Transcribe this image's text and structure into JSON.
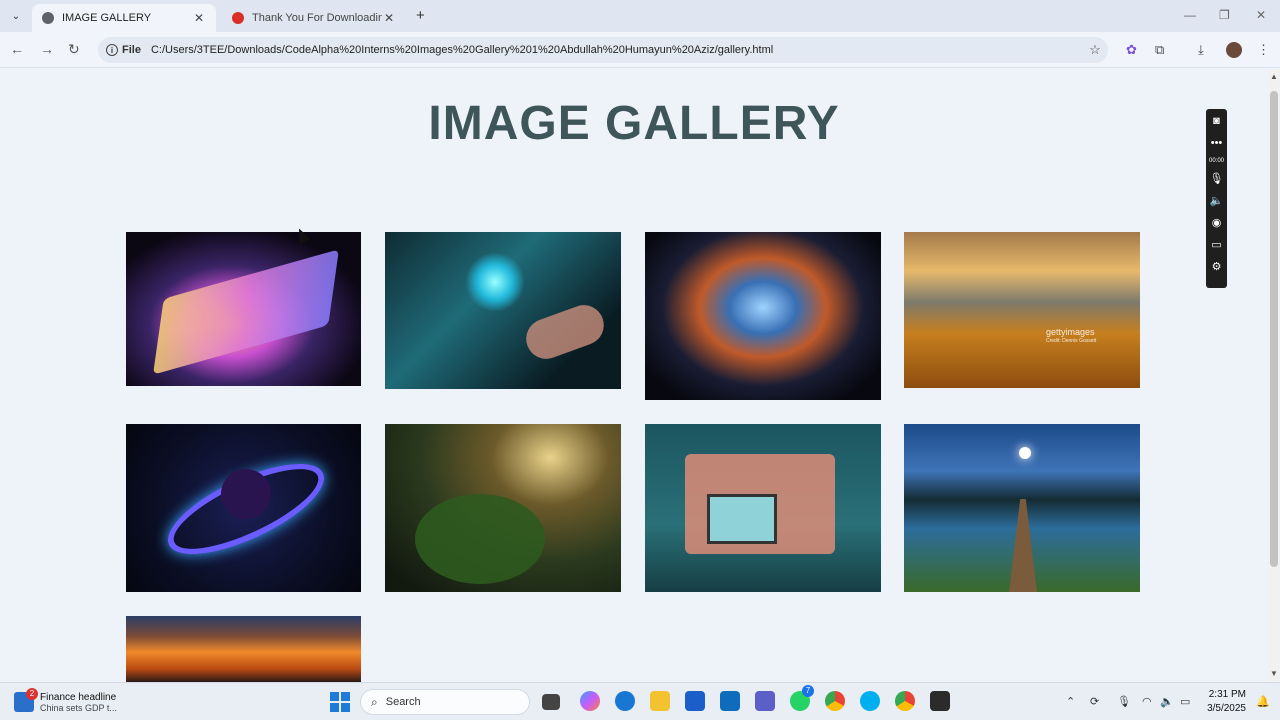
{
  "browser": {
    "tabs": [
      {
        "title": "IMAGE GALLERY",
        "active": true,
        "favicon_color": "#5f6368"
      },
      {
        "title": "Thank You For Downloading Sn",
        "active": false,
        "favicon_color": "#d93025"
      }
    ],
    "new_tab_icon": "plus-icon",
    "address": {
      "scheme_label": "File",
      "url": "C:/Users/3TEE/Downloads/CodeAlpha%20Interns%20Images%20Gallery%201%20Abdullah%20Humayun%20Aziz/gallery.html"
    }
  },
  "page": {
    "heading": "IMAGE GALLERY",
    "heading_color": "#3e5559",
    "background": "#eef3fa",
    "images": [
      {
        "subject": "laptop-neon",
        "row": 1,
        "col": 1
      },
      {
        "subject": "hands-typing-hologram",
        "row": 1,
        "col": 2
      },
      {
        "subject": "nebula-space",
        "row": 1,
        "col": 3
      },
      {
        "subject": "autumn-mountains",
        "row": 1,
        "col": 4,
        "watermark": "gettyimages",
        "credit": "Credit: Dennis Gossett"
      },
      {
        "subject": "ringed-planet",
        "row": 2,
        "col": 1
      },
      {
        "subject": "fantasy-plants",
        "row": 2,
        "col": 2
      },
      {
        "subject": "laptop-city-3d",
        "row": 2,
        "col": 3
      },
      {
        "subject": "lake-pier-night",
        "row": 2,
        "col": 4
      },
      {
        "subject": "sunset-clouds",
        "row": 3,
        "col": 1
      }
    ]
  },
  "recorder_toolbar": {
    "items": [
      "camera-icon",
      "more-icon",
      "timer",
      "mic-icon",
      "speaker-icon",
      "webcam-icon",
      "window-icon",
      "settings-icon"
    ],
    "timer": "00:00"
  },
  "taskbar": {
    "widget": {
      "headline": "Finance headline",
      "subtext": "China sets GDP t...",
      "badge": "2"
    },
    "search_placeholder": "Search",
    "whatsapp_badge": "7",
    "clock": {
      "time": "2:31 PM",
      "date": "3/5/2025"
    }
  }
}
